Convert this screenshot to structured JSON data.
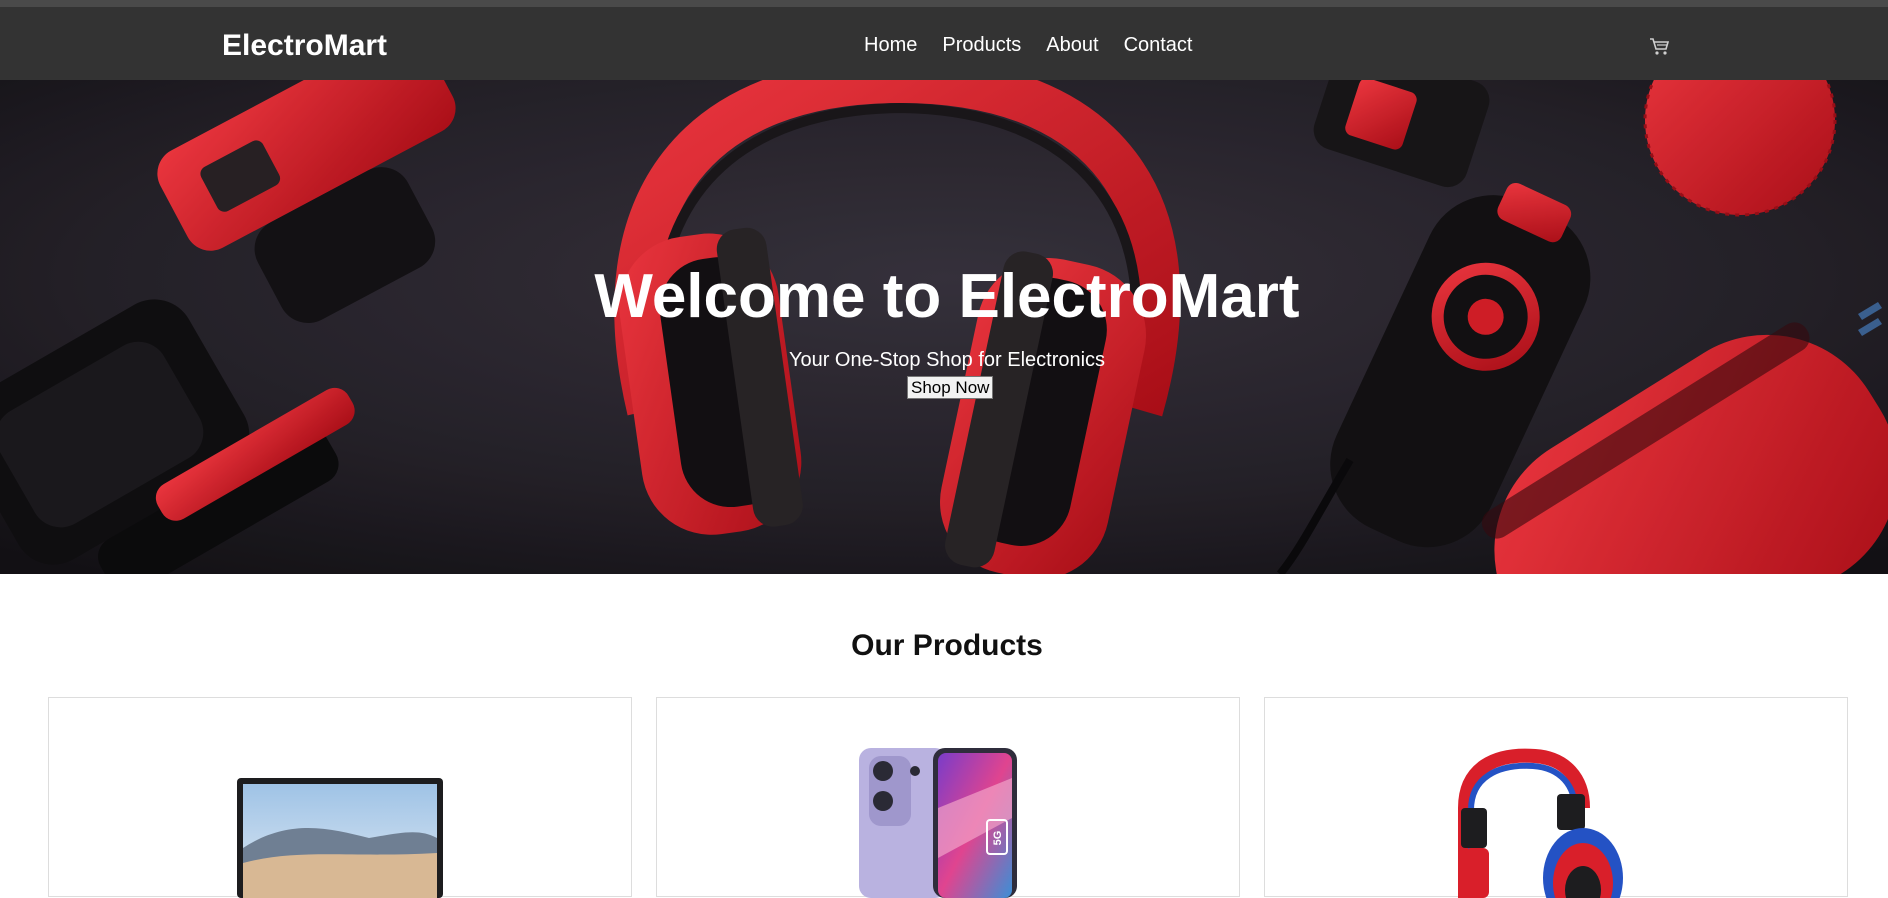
{
  "header": {
    "brand": "ElectroMart",
    "nav": [
      {
        "label": "Home"
      },
      {
        "label": "Products"
      },
      {
        "label": "About"
      },
      {
        "label": "Contact"
      }
    ],
    "cart_icon": "cart-icon"
  },
  "hero": {
    "title": "Welcome to ElectroMart",
    "subtitle": "Your One-Stop Shop for Electronics",
    "button_label": "Shop Now"
  },
  "products": {
    "heading": "Our Products",
    "items": [
      {
        "image": "laptop-image"
      },
      {
        "image": "smartphone-5g-image",
        "badge": "5G"
      },
      {
        "image": "headphones-image"
      }
    ]
  },
  "colors": {
    "navbar": "#333333",
    "hero_red": "#e0202a",
    "hero_dark": "#2a262e"
  }
}
